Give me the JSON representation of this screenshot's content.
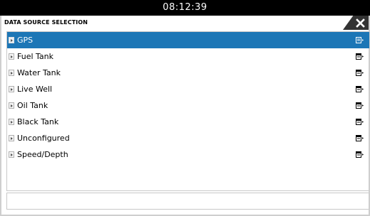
{
  "status_bar": {
    "time": "08:12:39"
  },
  "dialog": {
    "title": "DATA SOURCE SELECTION",
    "close_icon": "close-x-icon"
  },
  "sources": [
    {
      "label": "GPS",
      "selected": true
    },
    {
      "label": "Fuel Tank",
      "selected": false
    },
    {
      "label": "Water Tank",
      "selected": false
    },
    {
      "label": "Live Well",
      "selected": false
    },
    {
      "label": "Oil Tank",
      "selected": false
    },
    {
      "label": "Black Tank",
      "selected": false
    },
    {
      "label": "Unconfigured",
      "selected": false
    },
    {
      "label": "Speed/Depth",
      "selected": false
    }
  ],
  "icons": {
    "expander": "expand-arrow-icon",
    "row_menu": "context-menu-icon"
  },
  "colors": {
    "selection": "#1c76b6",
    "header_bar": "#000000",
    "close_button": "#333333"
  }
}
